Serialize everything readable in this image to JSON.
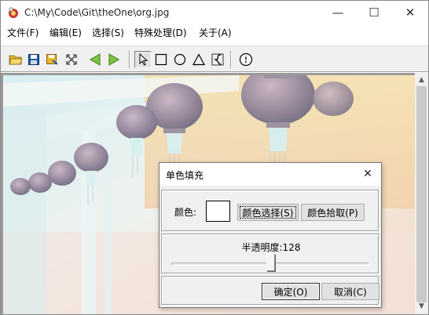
{
  "window": {
    "title": "C:\\My\\Code\\Git\\theOne\\org.jpg",
    "minimize_glyph": "—",
    "maximize_glyph": "☐",
    "close_glyph": "✕"
  },
  "menu": {
    "items": [
      {
        "label": "文件(F)"
      },
      {
        "label": "编辑(E)"
      },
      {
        "label": "选择(S)"
      },
      {
        "label": "特殊处理(D)"
      },
      {
        "label": "关于(A)"
      }
    ]
  },
  "toolbar": {
    "buttons": [
      {
        "icon": "open-folder-icon"
      },
      {
        "icon": "save-icon"
      },
      {
        "icon": "save-as-icon"
      },
      {
        "icon": "crossed-arrows-icon"
      },
      {
        "icon": "back-arrow-icon"
      },
      {
        "icon": "forward-arrow-icon"
      },
      {
        "icon": "pointer-icon",
        "pressed": true
      },
      {
        "icon": "rectangle-icon"
      },
      {
        "icon": "ellipse-icon"
      },
      {
        "icon": "triangle-icon"
      },
      {
        "icon": "freeform-icon"
      },
      {
        "icon": "info-icon"
      }
    ]
  },
  "image": {
    "subject": "inverted photo of hanging lanterns under an eave"
  },
  "dialog": {
    "title": "单色填充",
    "close_glyph": "✕",
    "color_label": "颜色:",
    "swatch_color": "#ffffff",
    "select_color_button": "颜色选择(S)",
    "pick_color_button": "颜色拾取(P)",
    "alpha_label": "半透明度:128",
    "alpha_value": 128,
    "alpha_max": 255,
    "ok_button": "确定(O)",
    "cancel_button": "取消(C)"
  },
  "colors": {
    "green_arrow": "#7dc542",
    "icon_blue": "#1f5fa8",
    "folder_yellow": "#e8b830"
  }
}
